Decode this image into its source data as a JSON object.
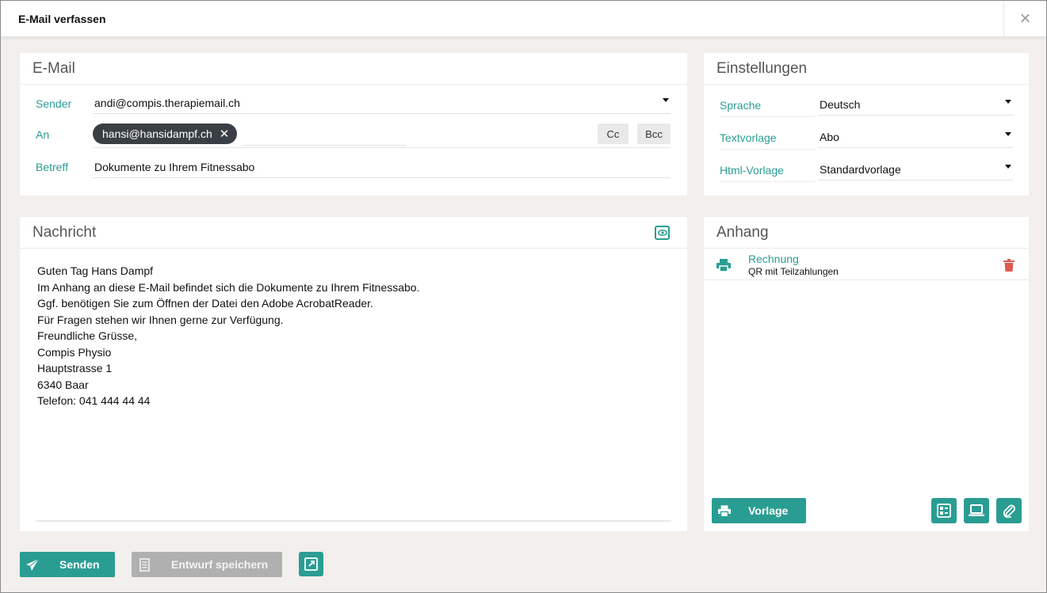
{
  "window": {
    "title": "E-Mail verfassen",
    "close_label": "×"
  },
  "email_panel": {
    "title": "E-Mail",
    "sender_label": "Sender",
    "sender_value": "andi@compis.therapiemail.ch",
    "to_label": "An",
    "to_chip": "hansi@hansidampf.ch",
    "cc_label": "Cc",
    "bcc_label": "Bcc",
    "subject_label": "Betreff",
    "subject_value": "Dokumente zu Ihrem Fitnessabo"
  },
  "settings_panel": {
    "title": "Einstellungen",
    "language_label": "Sprache",
    "language_value": "Deutsch",
    "text_template_label": "Textvorlage",
    "text_template_value": "Abo",
    "html_template_label": "Html-Vorlage",
    "html_template_value": "Standardvorlage"
  },
  "message_panel": {
    "title": "Nachricht",
    "body_lines": [
      "Guten Tag Hans Dampf",
      "",
      "Im Anhang an diese E-Mail befindet sich die Dokumente zu Ihrem Fitnessabo.",
      "Ggf. benötigen Sie zum Öffnen der Datei den Adobe AcrobatReader.",
      "",
      "Für Fragen stehen wir Ihnen gerne zur Verfügung.",
      "",
      "Freundliche Grüsse,",
      "",
      "Compis Physio",
      "Hauptstrasse 1",
      "6340 Baar",
      "Telefon: 041 444 44 44"
    ]
  },
  "attachment_panel": {
    "title": "Anhang",
    "items": [
      {
        "title": "Rechnung",
        "subtitle": "QR mit Teilzahlungen",
        "icon": "printer-icon"
      }
    ],
    "template_button": "Vorlage"
  },
  "footer": {
    "send_label": "Senden",
    "draft_label": "Entwurf speichern"
  },
  "colors": {
    "accent": "#2a9d93",
    "chip": "#3a3f45",
    "delete": "#e05a4f",
    "disabled": "#b0b0b0"
  }
}
